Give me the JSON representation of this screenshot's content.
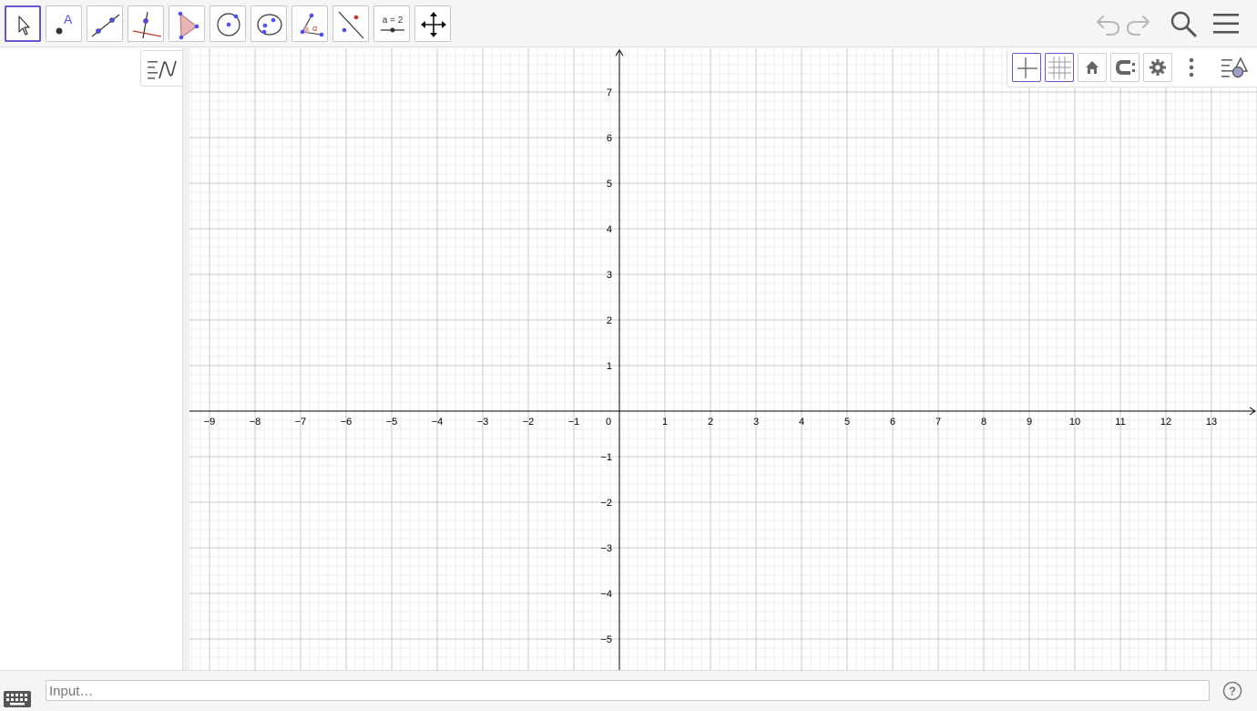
{
  "toolbar": {
    "tools": [
      {
        "name": "move-tool",
        "icon": "move-arrow-icon",
        "active": true
      },
      {
        "name": "point-tool",
        "icon": "point-icon",
        "label": "A"
      },
      {
        "name": "line-tool",
        "icon": "line-icon"
      },
      {
        "name": "perpendicular-line-tool",
        "icon": "perpendicular-line-icon"
      },
      {
        "name": "polygon-tool",
        "icon": "polygon-icon"
      },
      {
        "name": "circle-center-point-tool",
        "icon": "circle-icon"
      },
      {
        "name": "ellipse-tool",
        "icon": "ellipse-icon"
      },
      {
        "name": "angle-tool",
        "icon": "angle-icon",
        "label": "α"
      },
      {
        "name": "reflect-tool",
        "icon": "reflect-icon"
      },
      {
        "name": "slider-tool",
        "icon": "slider-icon",
        "label": "a = 2"
      },
      {
        "name": "move-graphics-view-tool",
        "icon": "move-view-icon"
      }
    ],
    "right_controls": [
      "undo-icon",
      "redo-icon",
      "search-icon",
      "menu-icon"
    ]
  },
  "algebra_panel": {
    "toggle_icon": "algebra-view-toggle-icon"
  },
  "style_bar": {
    "buttons": [
      "show-axes-icon",
      "show-grid-icon",
      "home-icon",
      "point-capturing-icon",
      "settings-icon",
      "more-icon",
      "graphics-view-toggle-icon"
    ]
  },
  "input_bar": {
    "placeholder": "Input…",
    "keyboard_icon": "keyboard-icon",
    "help_icon": "help-icon"
  },
  "colors": {
    "accent": "#6557d2",
    "toolbar_bg": "#f5f5f5",
    "point": "#4d4dff",
    "polygon_fill": "#e8b5b5",
    "icon_grey": "#666666"
  },
  "chart_data": {
    "type": "coordinate_grid",
    "x_ticks": [
      "−9",
      "−8",
      "−7",
      "−6",
      "−5",
      "−4",
      "−3",
      "−2",
      "−1",
      "0",
      "1",
      "2",
      "3",
      "4",
      "5",
      "6",
      "7",
      "8",
      "9",
      "10",
      "11",
      "12",
      "13"
    ],
    "y_ticks": [
      "7",
      "6",
      "5",
      "4",
      "3",
      "2",
      "1",
      "−1",
      "−2",
      "−3",
      "−4",
      "−5"
    ],
    "xlim": [
      -9.4,
      14.0
    ],
    "ylim": [
      -5.6,
      7.9
    ],
    "major_grid_step": 1,
    "minor_grid_step": 0.2,
    "grid": true,
    "axes": true
  }
}
